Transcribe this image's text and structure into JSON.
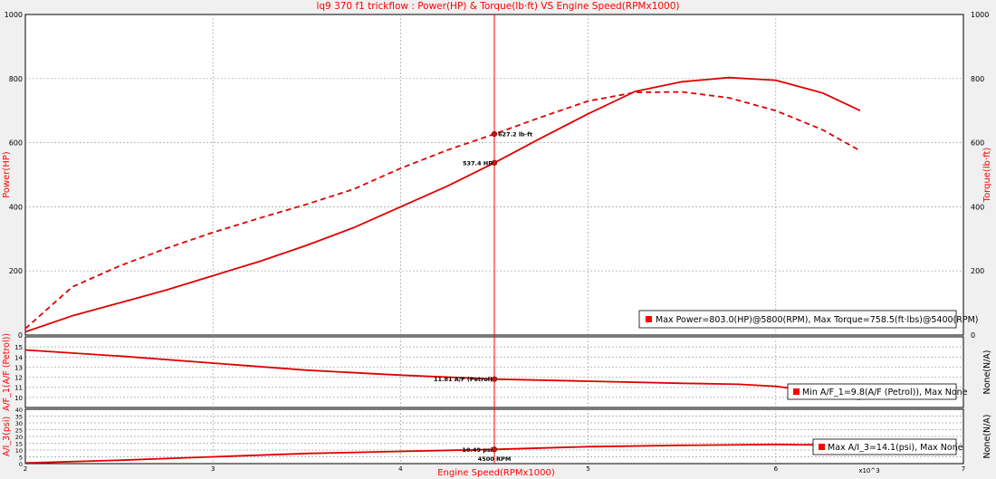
{
  "title": "lq9 370 f1 trickflow : Power(HP) & Torque(lb·ft) VS Engine Speed(RPMx1000)",
  "colors": {
    "accent": "#ff0000",
    "line": "#e00000",
    "grid": "#a0a0a0",
    "plot_bg": "#ffffff",
    "frame": "#000000"
  },
  "cursor": {
    "rpm_label": "4500 RPM",
    "x": 4.5
  },
  "x_axis": {
    "label": "Engine Speed(RPMx1000)",
    "ticks": [
      "2",
      "3",
      "4",
      "5",
      "6",
      "7"
    ],
    "exponent": "x10^3",
    "range": [
      2,
      7
    ]
  },
  "chart_data": [
    {
      "type": "line",
      "ylabel_left": "Power(HP)",
      "ylabel_right": "Torque(lb·ft)",
      "ylim": [
        0,
        1000
      ],
      "yticks": [
        "0",
        "200",
        "400",
        "600",
        "800",
        "1000"
      ],
      "grid": true,
      "legend": "bottom-right",
      "legend_text": "Max Power=803.0(HP)@5800(RPM), Max Torque=758.5(ft·lbs)@5400(RPM)",
      "series": [
        {
          "style": "solid",
          "x": [
            2.0,
            2.25,
            2.5,
            2.75,
            3.0,
            3.25,
            3.5,
            3.75,
            4.0,
            4.25,
            4.5,
            4.75,
            5.0,
            5.25,
            5.5,
            5.75,
            6.0,
            6.25,
            6.45
          ],
          "y": [
            10,
            60,
            100,
            140,
            185,
            230,
            280,
            335,
            400,
            465,
            537.4,
            615,
            690,
            760,
            790,
            803,
            795,
            755,
            700
          ]
        },
        {
          "style": "dashed",
          "x": [
            2.0,
            2.25,
            2.5,
            2.75,
            3.0,
            3.25,
            3.5,
            3.75,
            4.0,
            4.25,
            4.5,
            4.75,
            5.0,
            5.25,
            5.5,
            5.75,
            6.0,
            6.25,
            6.45
          ],
          "y": [
            20,
            150,
            215,
            270,
            320,
            365,
            408,
            455,
            520,
            577,
            627.2,
            680,
            730,
            757,
            758.5,
            740,
            700,
            640,
            575
          ]
        }
      ],
      "cursor_labels": [
        "537.4 HP",
        "627.2 lb·ft"
      ],
      "cursor_values": [
        537.4,
        627.2
      ]
    },
    {
      "type": "line",
      "ylabel_left": "A/F_1(A/F (Petrol))",
      "ylabel_right": "None(N/A)",
      "ylim": [
        9,
        16
      ],
      "yticks": [
        "10",
        "11",
        "12",
        "13",
        "14",
        "15"
      ],
      "grid": true,
      "legend": "bottom-right",
      "legend_text": "Min A/F_1=9.8(A/F (Petrol)), Max None",
      "series": [
        {
          "style": "solid",
          "x": [
            2.0,
            2.5,
            3.0,
            3.5,
            4.0,
            4.5,
            5.0,
            5.5,
            5.8,
            6.0,
            6.2,
            6.45
          ],
          "y": [
            14.7,
            14.1,
            13.4,
            12.7,
            12.2,
            11.81,
            11.6,
            11.4,
            11.3,
            11.1,
            10.6,
            9.8
          ]
        }
      ],
      "cursor_labels": [
        "11.81 A/F (Petrol)"
      ],
      "cursor_values": [
        11.81
      ]
    },
    {
      "type": "line",
      "ylabel_left": "A/I_3(psi)",
      "ylabel_right": "None(N/A)",
      "ylim": [
        0,
        40
      ],
      "yticks": [
        "0",
        "5",
        "10",
        "15",
        "20",
        "25",
        "30",
        "35",
        "40"
      ],
      "grid": true,
      "legend": "bottom-right",
      "legend_text": "Max A/I_3=14.1(psi), Max None",
      "series": [
        {
          "style": "solid",
          "x": [
            2.0,
            2.5,
            3.0,
            3.5,
            4.0,
            4.5,
            5.0,
            5.5,
            6.0,
            6.45
          ],
          "y": [
            0.5,
            2.5,
            5,
            7.5,
            9,
            10.49,
            12.5,
            13.5,
            14.1,
            13.5
          ]
        }
      ],
      "cursor_labels": [
        "10.49 psi"
      ],
      "cursor_values": [
        10.49
      ]
    }
  ]
}
